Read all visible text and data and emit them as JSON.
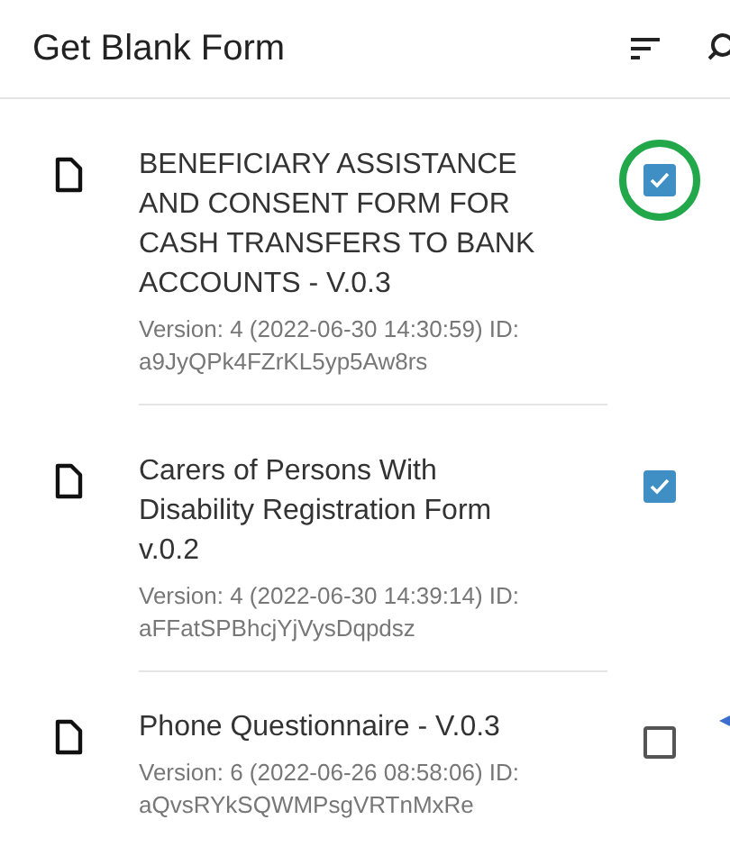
{
  "app_bar": {
    "title": "Get Blank Form"
  },
  "forms": [
    {
      "title": "BENEFICIARY ASSISTANCE AND CONSENT FORM FOR CASH TRANSFERS TO BANK ACCOUNTS - V.0.3",
      "details": "Version: 4 (2022-06-30 14:30:59) ID: a9JyQPk4FZrKL5yp5Aw8rs",
      "checked": true,
      "circled": true,
      "pointed_at": false
    },
    {
      "title": "Carers of Persons With Disability Registration Form v.0.2",
      "details": "Version: 4 (2022-06-30 14:39:14) ID: aFFatSPBhcjYjVysDqpdsz",
      "checked": true,
      "circled": false,
      "pointed_at": false
    },
    {
      "title": "Phone Questionnaire - V.0.3",
      "details": "Version: 6 (2022-06-26 08:58:06) ID: aQvsRYkSQWMPsgVRTnMxRe",
      "checked": false,
      "circled": false,
      "pointed_at": true
    }
  ]
}
